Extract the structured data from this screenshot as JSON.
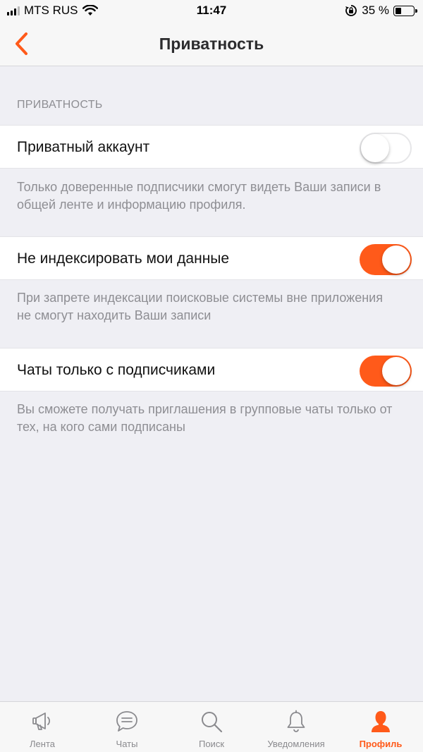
{
  "status_bar": {
    "carrier": "MTS RUS",
    "time": "11:47",
    "battery_percent": "35 %",
    "battery_level": 0.35
  },
  "nav": {
    "title": "Приватность",
    "back_icon": "chevron-left-icon"
  },
  "section": {
    "header": "ПРИВАТНОСТЬ"
  },
  "settings": [
    {
      "label": "Приватный аккаунт",
      "enabled": false,
      "footnote": "Только доверенные подписчики смогут видеть Ваши записи в общей ленте и информацию профиля."
    },
    {
      "label": "Не индексировать мои данные",
      "enabled": true,
      "footnote": "При запрете индексации поисковые системы вне приложения не смогут находить Ваши записи"
    },
    {
      "label": "Чаты только с подписчиками",
      "enabled": true,
      "footnote": "Вы сможете получать приглашения в групповые чаты только от тех, на кого сами подписаны"
    }
  ],
  "tabs": [
    {
      "label": "Лента",
      "icon": "megaphone-icon",
      "active": false
    },
    {
      "label": "Чаты",
      "icon": "chat-bubble-icon",
      "active": false
    },
    {
      "label": "Поиск",
      "icon": "search-icon",
      "active": false
    },
    {
      "label": "Уведомления",
      "icon": "bell-icon",
      "active": false
    },
    {
      "label": "Профиль",
      "icon": "profile-icon",
      "active": true
    }
  ],
  "colors": {
    "accent": "#ff5a1a",
    "background": "#efeff4",
    "secondary_text": "#8e8e93"
  }
}
